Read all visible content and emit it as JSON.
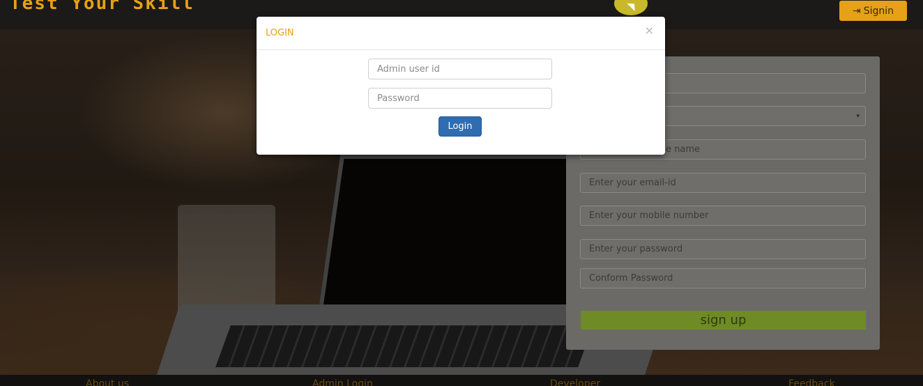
{
  "header": {
    "brand": "Test Your Skill",
    "signin_icon": "sign-in-icon",
    "signin_label": "Signin"
  },
  "modal": {
    "title": "LOGIN",
    "close_label": "×",
    "admin_id_placeholder": "Admin user id",
    "password_placeholder": "Password",
    "login_label": "Login"
  },
  "signup": {
    "fields": [
      "",
      "",
      "e name",
      "Enter your email-id",
      "Enter your mobile number",
      "Enter your password",
      "Conform Password"
    ],
    "select_caret": "▾",
    "submit_label": "sign up"
  },
  "footer": {
    "links": [
      "About us",
      "Admin Login",
      "Developer",
      "Feedback"
    ]
  },
  "colors": {
    "brand": "#e5a117",
    "primary": "#2f6db0",
    "signup": "#8cb82a"
  }
}
